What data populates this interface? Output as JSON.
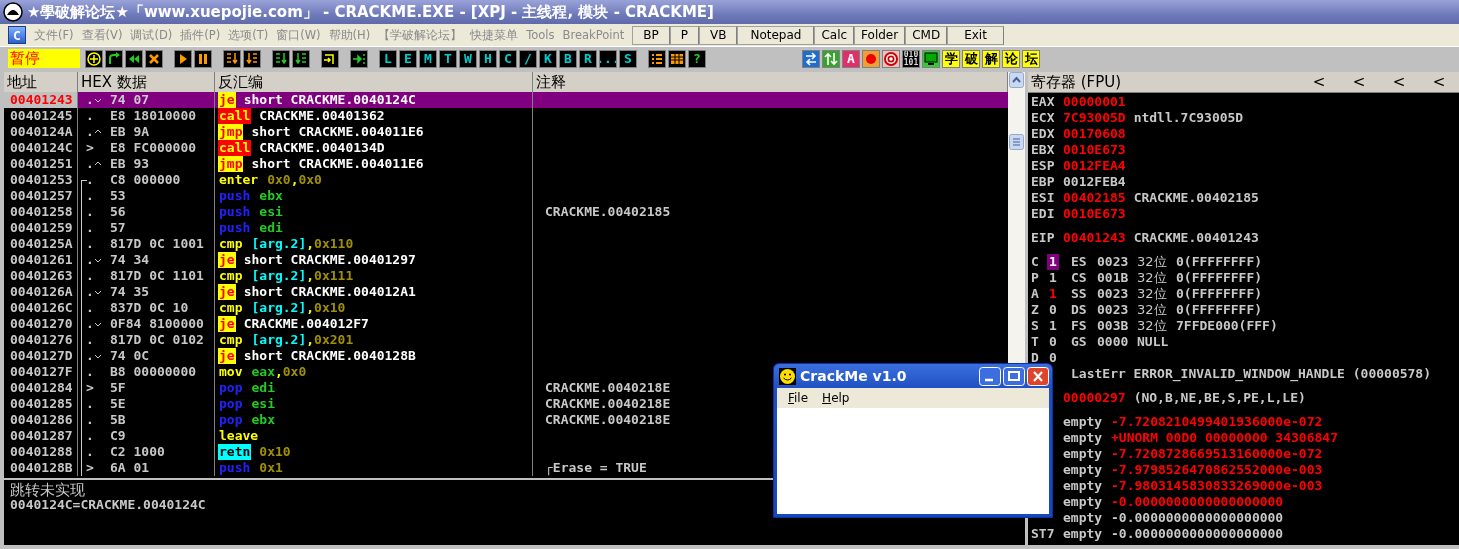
{
  "window": {
    "title": "★學破解论坛★「www.xuepojie.com」 - CRACKME.EXE - [XPJ - 主线程, 模块 - CRACKME]"
  },
  "menu": {
    "icon_label": "C",
    "items": [
      "文件(F)",
      "查看(V)",
      "调试(D)",
      "插件(P)",
      "选项(T)",
      "窗口(W)",
      "帮助(H)",
      "【学破解论坛】",
      "快捷菜单",
      "Tools",
      "BreakPoint"
    ],
    "buttons": [
      "BP",
      "P",
      "VB",
      "Notepad",
      "Calc",
      "Folder",
      "CMD",
      "Exit"
    ]
  },
  "toolbar": {
    "status": "暂停",
    "groups": [
      [
        {
          "kind": "icon"
        },
        {
          "kind": "icon"
        },
        {
          "kind": "icon"
        },
        {
          "kind": "icon"
        }
      ],
      [
        {
          "kind": "icon"
        },
        {
          "kind": "icon"
        }
      ],
      [
        {
          "kind": "icon"
        },
        {
          "kind": "icon"
        }
      ],
      [
        {
          "kind": "icon"
        },
        {
          "kind": "icon"
        }
      ],
      [
        {
          "kind": "icon"
        }
      ],
      [
        {
          "kind": "icon"
        }
      ],
      [
        {
          "kind": "letter",
          "label": "L"
        },
        {
          "kind": "letter",
          "label": "E"
        },
        {
          "kind": "letter",
          "label": "M"
        },
        {
          "kind": "letter",
          "label": "T"
        },
        {
          "kind": "letter",
          "label": "W"
        },
        {
          "kind": "letter",
          "label": "H"
        },
        {
          "kind": "letter",
          "label": "C"
        },
        {
          "kind": "letter",
          "label": "/"
        },
        {
          "kind": "letter",
          "label": "K"
        },
        {
          "kind": "letter",
          "label": "B"
        },
        {
          "kind": "letter",
          "label": "R"
        },
        {
          "kind": "letter",
          "label": "..."
        },
        {
          "kind": "letter",
          "label": "S"
        }
      ],
      [
        {
          "kind": "icon"
        },
        {
          "kind": "icon"
        },
        {
          "kind": "help",
          "label": "?"
        }
      ],
      [
        {
          "kind": "icon"
        },
        {
          "kind": "icon"
        },
        {
          "kind": "badge",
          "label": "A"
        },
        {
          "kind": "icon"
        },
        {
          "kind": "icon"
        },
        {
          "kind": "binary",
          "label": "010 101"
        },
        {
          "kind": "icon"
        },
        {
          "kind": "hanzi",
          "label": "学"
        },
        {
          "kind": "hanzi",
          "label": "破"
        },
        {
          "kind": "hanzi",
          "label": "解"
        },
        {
          "kind": "hanzi",
          "label": "论"
        },
        {
          "kind": "hanzi",
          "label": "坛"
        }
      ]
    ]
  },
  "disasm": {
    "columns": [
      "地址",
      "HEX 数据",
      "反汇编",
      "注释"
    ],
    "rows": [
      {
        "address": "00401243",
        "marker": ".",
        "jumps_down": true,
        "jumps_up": false,
        "proc_start": false,
        "in_proc": false,
        "hex": "74 07",
        "mnemonic": "je",
        "kind": "jump",
        "operands": [
          {
            "text": "short CRACKME.0040124C",
            "kind": "sym"
          }
        ],
        "selected": true
      },
      {
        "address": "00401245",
        "marker": ".",
        "jumps_down": false,
        "jumps_up": false,
        "proc_start": false,
        "in_proc": false,
        "hex": "E8 18010000",
        "mnemonic": "call",
        "kind": "call",
        "operands": [
          {
            "text": "CRACKME.00401362",
            "kind": "sym"
          }
        ],
        "selected": false
      },
      {
        "address": "0040124A",
        "marker": ".",
        "jumps_down": false,
        "jumps_up": true,
        "proc_start": false,
        "in_proc": false,
        "hex": "EB 9A",
        "mnemonic": "jmp",
        "kind": "jump",
        "operands": [
          {
            "text": "short CRACKME.004011E6",
            "kind": "sym"
          }
        ],
        "selected": false
      },
      {
        "address": "0040124C",
        "marker": ">",
        "jumps_down": false,
        "jumps_up": false,
        "proc_start": false,
        "in_proc": false,
        "hex": "E8 FC000000",
        "mnemonic": "call",
        "kind": "call",
        "operands": [
          {
            "text": "CRACKME.0040134D",
            "kind": "sym"
          }
        ],
        "selected": false
      },
      {
        "address": "00401251",
        "marker": ".",
        "jumps_down": false,
        "jumps_up": true,
        "proc_start": false,
        "in_proc": false,
        "hex": "EB 93",
        "mnemonic": "jmp",
        "kind": "jump",
        "operands": [
          {
            "text": "short CRACKME.004011E6",
            "kind": "sym"
          }
        ],
        "selected": false
      },
      {
        "address": "00401253",
        "marker": ".",
        "jumps_down": false,
        "jumps_up": false,
        "proc_start": true,
        "in_proc": true,
        "hex": "C8 000000",
        "mnemonic": "enter",
        "kind": "plain",
        "operands": [
          {
            "text": "0x0",
            "kind": "imm"
          },
          {
            "text": ",",
            "kind": "sep"
          },
          {
            "text": "0x0",
            "kind": "imm"
          }
        ],
        "selected": false
      },
      {
        "address": "00401257",
        "marker": ".",
        "jumps_down": false,
        "jumps_up": false,
        "proc_start": false,
        "in_proc": true,
        "hex": "53",
        "mnemonic": "push",
        "kind": "stack",
        "operands": [
          {
            "text": "ebx",
            "kind": "reg"
          }
        ],
        "selected": false
      },
      {
        "address": "00401258",
        "marker": ".",
        "jumps_down": false,
        "jumps_up": false,
        "proc_start": false,
        "in_proc": true,
        "hex": "56",
        "mnemonic": "push",
        "kind": "stack",
        "operands": [
          {
            "text": "esi",
            "kind": "reg"
          }
        ],
        "comment": "CRACKME.00402185",
        "selected": false
      },
      {
        "address": "00401259",
        "marker": ".",
        "jumps_down": false,
        "jumps_up": false,
        "proc_start": false,
        "in_proc": true,
        "hex": "57",
        "mnemonic": "push",
        "kind": "stack",
        "operands": [
          {
            "text": "edi",
            "kind": "reg"
          }
        ],
        "selected": false
      },
      {
        "address": "0040125A",
        "marker": ".",
        "jumps_down": false,
        "jumps_up": false,
        "proc_start": false,
        "in_proc": true,
        "hex": "817D 0C 1001",
        "mnemonic": "cmp",
        "kind": "plain",
        "operands": [
          {
            "text": "[arg.2]",
            "kind": "mem"
          },
          {
            "text": ",",
            "kind": "sep"
          },
          {
            "text": "0x110",
            "kind": "imm"
          }
        ],
        "selected": false
      },
      {
        "address": "00401261",
        "marker": ".",
        "jumps_down": true,
        "jumps_up": false,
        "proc_start": false,
        "in_proc": true,
        "hex": "74 34",
        "mnemonic": "je",
        "kind": "jump",
        "operands": [
          {
            "text": "short CRACKME.00401297",
            "kind": "sym"
          }
        ],
        "selected": false
      },
      {
        "address": "00401263",
        "marker": ".",
        "jumps_down": false,
        "jumps_up": false,
        "proc_start": false,
        "in_proc": true,
        "hex": "817D 0C 1101",
        "mnemonic": "cmp",
        "kind": "plain",
        "operands": [
          {
            "text": "[arg.2]",
            "kind": "mem"
          },
          {
            "text": ",",
            "kind": "sep"
          },
          {
            "text": "0x111",
            "kind": "imm"
          }
        ],
        "selected": false
      },
      {
        "address": "0040126A",
        "marker": ".",
        "jumps_down": true,
        "jumps_up": false,
        "proc_start": false,
        "in_proc": true,
        "hex": "74 35",
        "mnemonic": "je",
        "kind": "jump",
        "operands": [
          {
            "text": "short CRACKME.004012A1",
            "kind": "sym"
          }
        ],
        "selected": false
      },
      {
        "address": "0040126C",
        "marker": ".",
        "jumps_down": false,
        "jumps_up": false,
        "proc_start": false,
        "in_proc": true,
        "hex": "837D 0C 10",
        "mnemonic": "cmp",
        "kind": "plain",
        "operands": [
          {
            "text": "[arg.2]",
            "kind": "mem"
          },
          {
            "text": ",",
            "kind": "sep"
          },
          {
            "text": "0x10",
            "kind": "imm"
          }
        ],
        "selected": false
      },
      {
        "address": "00401270",
        "marker": ".",
        "jumps_down": true,
        "jumps_up": false,
        "proc_start": false,
        "in_proc": true,
        "hex": "0F84 8100000",
        "mnemonic": "je",
        "kind": "jump",
        "operands": [
          {
            "text": "CRACKME.004012F7",
            "kind": "sym"
          }
        ],
        "selected": false
      },
      {
        "address": "00401276",
        "marker": ".",
        "jumps_down": false,
        "jumps_up": false,
        "proc_start": false,
        "in_proc": true,
        "hex": "817D 0C 0102",
        "mnemonic": "cmp",
        "kind": "plain",
        "operands": [
          {
            "text": "[arg.2]",
            "kind": "mem"
          },
          {
            "text": ",",
            "kind": "sep"
          },
          {
            "text": "0x201",
            "kind": "imm"
          }
        ],
        "selected": false
      },
      {
        "address": "0040127D",
        "marker": ".",
        "jumps_down": true,
        "jumps_up": false,
        "proc_start": false,
        "in_proc": true,
        "hex": "74 0C",
        "mnemonic": "je",
        "kind": "jump",
        "operands": [
          {
            "text": "short CRACKME.0040128B",
            "kind": "sym"
          }
        ],
        "selected": false
      },
      {
        "address": "0040127F",
        "marker": ".",
        "jumps_down": false,
        "jumps_up": false,
        "proc_start": false,
        "in_proc": true,
        "hex": "B8 00000000",
        "mnemonic": "mov",
        "kind": "plain",
        "operands": [
          {
            "text": "eax",
            "kind": "reg"
          },
          {
            "text": ",",
            "kind": "sep"
          },
          {
            "text": "0x0",
            "kind": "imm"
          }
        ],
        "selected": false
      },
      {
        "address": "00401284",
        "marker": ">",
        "jumps_down": false,
        "jumps_up": false,
        "proc_start": false,
        "in_proc": true,
        "hex": "5F",
        "mnemonic": "pop",
        "kind": "stack",
        "operands": [
          {
            "text": "edi",
            "kind": "reg"
          }
        ],
        "comment": "CRACKME.0040218E",
        "selected": false
      },
      {
        "address": "00401285",
        "marker": ".",
        "jumps_down": false,
        "jumps_up": false,
        "proc_start": false,
        "in_proc": true,
        "hex": "5E",
        "mnemonic": "pop",
        "kind": "stack",
        "operands": [
          {
            "text": "esi",
            "kind": "reg"
          }
        ],
        "comment": "CRACKME.0040218E",
        "selected": false
      },
      {
        "address": "00401286",
        "marker": ".",
        "jumps_down": false,
        "jumps_up": false,
        "proc_start": false,
        "in_proc": true,
        "hex": "5B",
        "mnemonic": "pop",
        "kind": "stack",
        "operands": [
          {
            "text": "ebx",
            "kind": "reg"
          }
        ],
        "comment": "CRACKME.0040218E",
        "selected": false
      },
      {
        "address": "00401287",
        "marker": ".",
        "jumps_down": false,
        "jumps_up": false,
        "proc_start": false,
        "in_proc": true,
        "hex": "C9",
        "mnemonic": "leave",
        "kind": "plain",
        "operands": [],
        "selected": false
      },
      {
        "address": "00401288",
        "marker": ".",
        "jumps_down": false,
        "jumps_up": false,
        "proc_start": false,
        "in_proc": true,
        "hex": "C2 1000",
        "mnemonic": "retn",
        "kind": "ret",
        "operands": [
          {
            "text": "0x10",
            "kind": "imm"
          }
        ],
        "selected": false
      },
      {
        "address": "0040128B",
        "marker": ">",
        "jumps_down": false,
        "jumps_up": false,
        "proc_start": false,
        "in_proc": true,
        "hex": "6A 01",
        "mnemonic": "push",
        "kind": "stack",
        "operands": [
          {
            "text": "0x1",
            "kind": "imm"
          }
        ],
        "comment": "┌Erase = TRUE",
        "selected": false
      }
    ]
  },
  "info": {
    "lines": [
      "跳转未实现",
      "0040124C=CRACKME.0040124C"
    ]
  },
  "registers_pane": {
    "title": "寄存器 (FPU)",
    "arrows": [
      "<",
      "<",
      "<",
      "<"
    ],
    "registers": [
      {
        "name": "EAX",
        "value": "00000001",
        "changed": true
      },
      {
        "name": "ECX",
        "value": "7C93005D",
        "changed": true,
        "comment": "ntdll.7C93005D"
      },
      {
        "name": "EDX",
        "value": "00170608",
        "changed": true
      },
      {
        "name": "EBX",
        "value": "0010E673",
        "changed": true
      },
      {
        "name": "ESP",
        "value": "0012FEA4",
        "changed": true
      },
      {
        "name": "EBP",
        "value": "0012FEB4",
        "changed": false
      },
      {
        "name": "ESI",
        "value": "00402185",
        "changed": true,
        "comment": "CRACKME.00402185"
      },
      {
        "name": "EDI",
        "value": "0010E673",
        "changed": true
      }
    ],
    "eip": {
      "name": "EIP",
      "value": "00401243",
      "changed": true,
      "comment": "CRACKME.00401243"
    },
    "flags": [
      {
        "name": "C",
        "value": "1",
        "changed": false,
        "selected": true,
        "segment": {
          "name": "ES",
          "selector": "0023",
          "bits": "32位",
          "info": "0(FFFFFFFF)"
        }
      },
      {
        "name": "P",
        "value": "1",
        "changed": false,
        "selected": false,
        "segment": {
          "name": "CS",
          "selector": "001B",
          "bits": "32位",
          "info": "0(FFFFFFFF)"
        }
      },
      {
        "name": "A",
        "value": "1",
        "changed": true,
        "selected": false,
        "segment": {
          "name": "SS",
          "selector": "0023",
          "bits": "32位",
          "info": "0(FFFFFFFF)"
        }
      },
      {
        "name": "Z",
        "value": "0",
        "changed": false,
        "selected": false,
        "segment": {
          "name": "DS",
          "selector": "0023",
          "bits": "32位",
          "info": "0(FFFFFFFF)"
        }
      },
      {
        "name": "S",
        "value": "1",
        "changed": false,
        "selected": false,
        "segment": {
          "name": "FS",
          "selector": "003B",
          "bits": "32位",
          "info": "7FFDE000(FFF)"
        }
      },
      {
        "name": "T",
        "value": "0",
        "changed": false,
        "selected": false,
        "segment": {
          "name": "GS",
          "selector": "0000",
          "info": "NULL"
        }
      },
      {
        "name": "D",
        "value": "0",
        "changed": false,
        "selected": false
      }
    ],
    "last_error": "LastErr ERROR_INVALID_WINDOW_HANDLE (00000578)",
    "efl": {
      "value": "00000297",
      "changed": true,
      "info": "(NO,B,NE,BE,S,PE,L,LE)"
    },
    "fpu": [
      {
        "tag": "empty",
        "value": "-7.7208210499401936000e-072",
        "changed": true
      },
      {
        "tag": "empty",
        "value": "+UNORM 00D0 00000000 34306847",
        "changed": true
      },
      {
        "tag": "empty",
        "value": "-7.7208728669513160000e-072",
        "changed": true
      },
      {
        "tag": "empty",
        "value": "-7.9798526470862552000e-003",
        "changed": true
      },
      {
        "tag": "empty",
        "value": "-7.9803145830833269000e-003",
        "changed": true
      },
      {
        "tag": "empty",
        "value": "-0.0000000000000000000",
        "changed": true
      },
      {
        "tag": "empty",
        "value": "-0.0000000000000000000",
        "changed": false
      },
      {
        "name": "ST7",
        "tag": "empty",
        "value": "-0.0000000000000000000",
        "changed": false
      }
    ]
  },
  "dialog": {
    "title": "CrackMe v1.0",
    "menu": [
      "File",
      "Help"
    ]
  }
}
